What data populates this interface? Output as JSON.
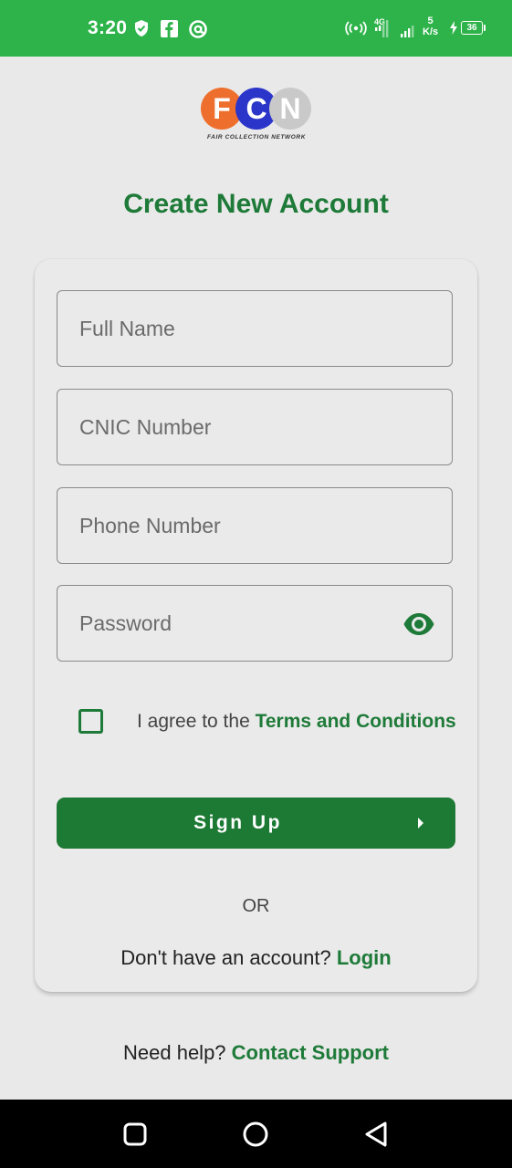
{
  "status_bar": {
    "time": "3:20",
    "net_type": "4G",
    "net_speed_value": "5",
    "net_speed_unit": "K/s",
    "battery": "36"
  },
  "logo": {
    "letter_1": "F",
    "letter_2": "C",
    "letter_3": "N",
    "tagline": "FAIR COLLECTION NETWORK"
  },
  "page": {
    "title": "Create New Account"
  },
  "form": {
    "full_name_placeholder": "Full Name",
    "cnic_placeholder": "CNIC Number",
    "phone_placeholder": "Phone Number",
    "password_placeholder": "Password",
    "terms_prefix": "I agree to the ",
    "terms_link": "Terms and Conditions",
    "signup_label": "Sign Up"
  },
  "footer": {
    "or_text": "OR",
    "no_account_text": "Don't have an account?",
    "login_link": "Login",
    "help_text": "Need help?",
    "support_link": "Contact Support"
  },
  "colors": {
    "status_bar": "#2db34a",
    "primary_green": "#1e7a38",
    "button_green": "#1c7a34",
    "background": "#e9e9e9",
    "logo_orange": "#ee6f2d",
    "logo_blue": "#2b35c9",
    "logo_grey": "#c9c9c9"
  },
  "icons": {
    "status": [
      "shield-icon",
      "facebook-icon",
      "at-sign-icon",
      "hotspot-icon",
      "signal-icon",
      "charging-icon",
      "battery-icon"
    ],
    "password_toggle": "eye-icon",
    "signup_arrow": "caret-right-icon",
    "nav": [
      "square-recents-icon",
      "circle-home-icon",
      "triangle-back-icon"
    ]
  }
}
